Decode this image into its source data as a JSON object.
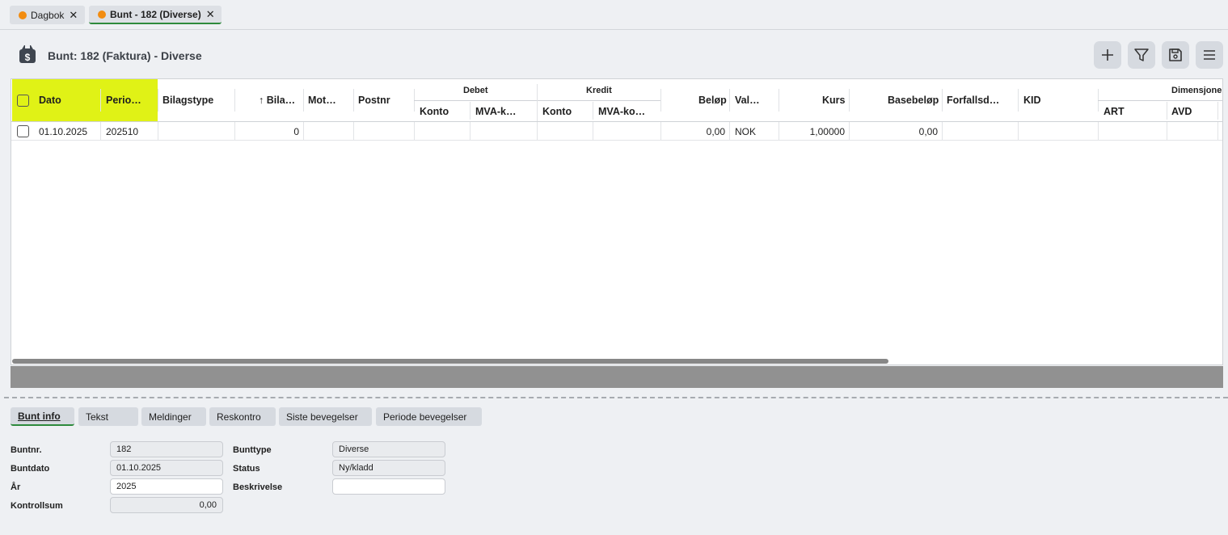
{
  "tabs": [
    {
      "label": "Dagbok",
      "close": "✕",
      "dot_color": "#f28c10"
    },
    {
      "label": "Bunt - 182 (Diverse)",
      "close": "✕",
      "dot_color": "#f28c10"
    }
  ],
  "header": {
    "title": "Bunt: 182 (Faktura) - Diverse",
    "buttons": [
      "plus-icon",
      "filter-icon",
      "save-icon",
      "menu-icon"
    ]
  },
  "grid": {
    "columns": {
      "dato": "Dato",
      "periode": "Perio…",
      "bilagstype": "Bilagstype",
      "bilag": "↑ Bila…",
      "mot": "Mot…",
      "postnr": "Postnr",
      "debet": "Debet",
      "debet_konto": "Konto",
      "debet_mva": "MVA-k…",
      "kredit": "Kredit",
      "kredit_konto": "Konto",
      "kredit_mva": "MVA-ko…",
      "belop": "Beløp",
      "valuta": "Val…",
      "kurs": "Kurs",
      "basebelop": "Basebeløp",
      "forfall": "Forfallsd…",
      "kid": "KID",
      "dimensjoner": "Dimensjone",
      "art": "ART",
      "avd": "AVD"
    },
    "rows": [
      {
        "dato": "01.10.2025",
        "periode": "202510",
        "bilag": "0",
        "belop": "0,00",
        "valuta": "NOK",
        "kurs": "1,00000",
        "basebelop": "0,00"
      }
    ],
    "highlight_color": "#e0f216"
  },
  "bottom_tabs": [
    {
      "label": "Bunt info"
    },
    {
      "label": "Tekst"
    },
    {
      "label": "Meldinger"
    },
    {
      "label": "Reskontro"
    },
    {
      "label": "Siste bevegelser"
    },
    {
      "label": "Periode bevegelser"
    }
  ],
  "info": {
    "buntnr_label": "Buntnr.",
    "buntnr": "182",
    "buntdato_label": "Buntdato",
    "buntdato": "01.10.2025",
    "ar_label": "År",
    "ar": "2025",
    "kontrollsum_label": "Kontrollsum",
    "kontrollsum": "0,00",
    "bunttype_label": "Bunttype",
    "bunttype": "Diverse",
    "status_label": "Status",
    "status": "Ny/kladd",
    "beskrivelse_label": "Beskrivelse",
    "beskrivelse": ""
  }
}
